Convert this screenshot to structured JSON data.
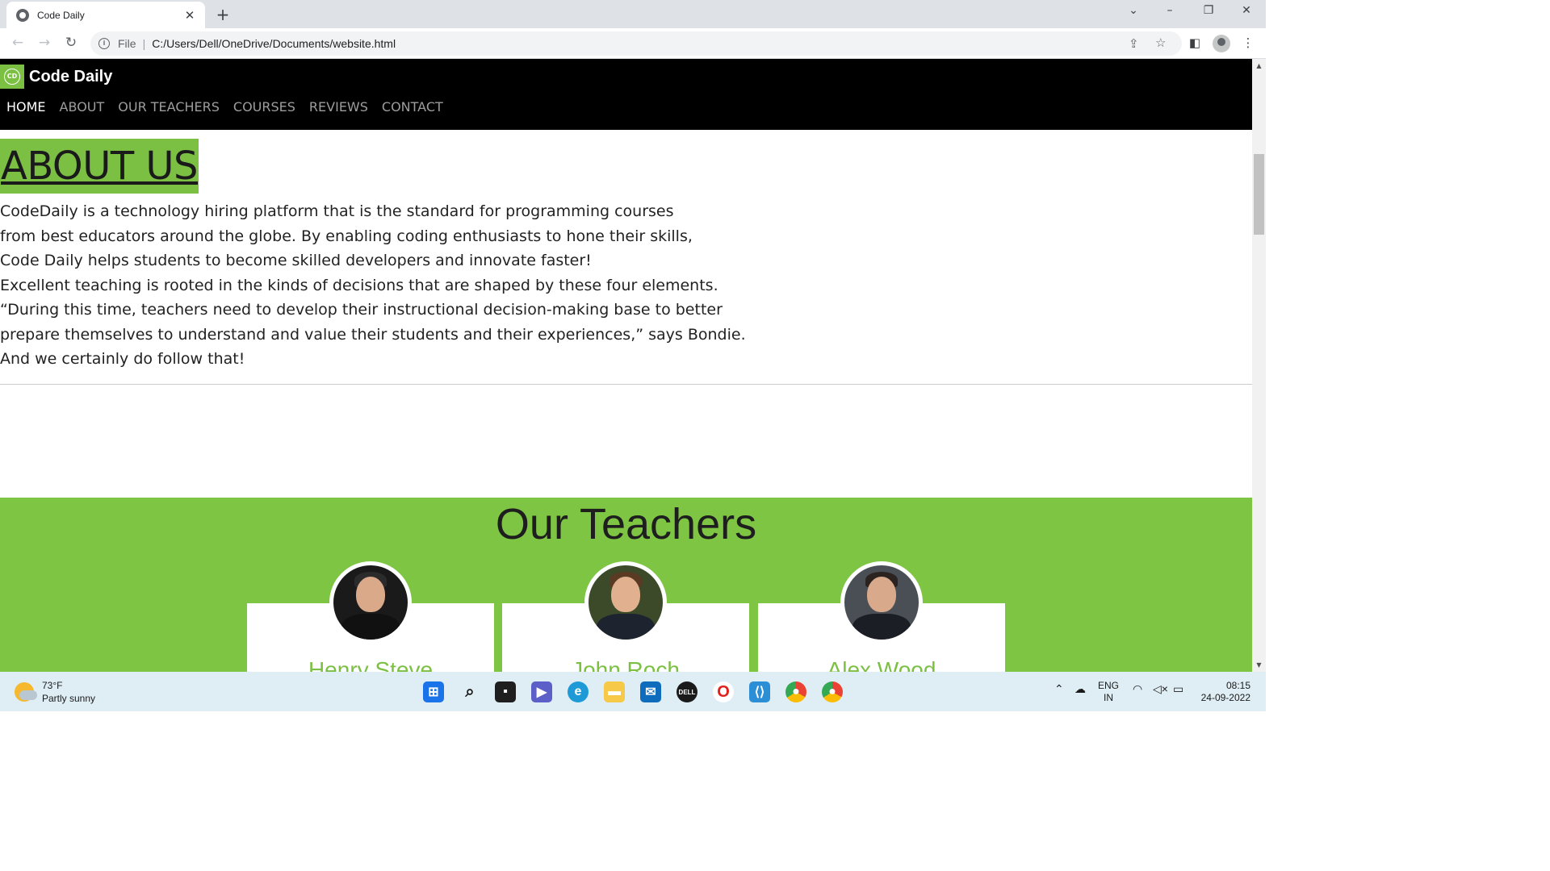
{
  "browser": {
    "tab_title": "Code Daily",
    "url_scheme": "File",
    "url": "C:/Users/Dell/OneDrive/Documents/website.html"
  },
  "site": {
    "brand": "Code Daily",
    "logo_text": "CD",
    "nav": [
      "HOME",
      "ABOUT",
      "OUR TEACHERS",
      "COURSES",
      "REVIEWS",
      "CONTACT"
    ],
    "active_nav": "HOME"
  },
  "about": {
    "heading": "ABOUT US",
    "lines": [
      "CodeDaily is a technology hiring platform that is the standard for programming courses",
      "from best educators around the globe. By enabling coding enthusiasts to hone their skills,",
      "Code Daily helps students to become skilled developers and innovate faster!",
      "Excellent teaching is rooted in the kinds of decisions that are shaped by these four elements.",
      "“During this time, teachers need to develop their instructional decision-making base to better",
      "prepare themselves to understand and value their students and their experiences,” says Bondie.",
      "And we certainly do follow that!"
    ]
  },
  "teachers": {
    "heading": "Our Teachers",
    "people": [
      {
        "name": "Henry Steve"
      },
      {
        "name": "John Roch"
      },
      {
        "name": "Alex Wood"
      }
    ]
  },
  "colors": {
    "accent_green": "#7bc043",
    "section_green": "#7ec544",
    "nav_bg": "#000000"
  },
  "taskbar": {
    "temperature": "73°F",
    "weather": "Partly sunny",
    "lang_top": "ENG",
    "lang_bottom": "IN",
    "time": "08:15",
    "date": "24-09-2022"
  }
}
